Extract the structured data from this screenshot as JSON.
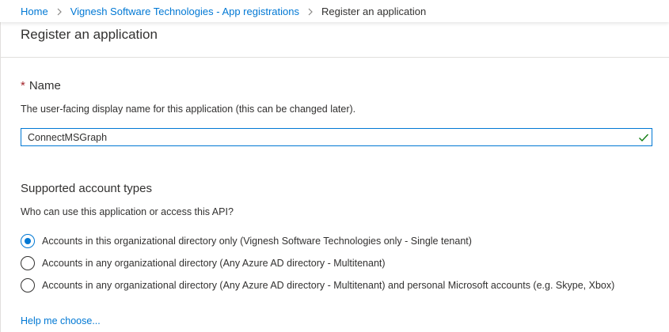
{
  "breadcrumb": {
    "home": "Home",
    "parent": "Vignesh Software Technologies - App registrations",
    "current": "Register an application"
  },
  "page": {
    "title": "Register an application"
  },
  "name_section": {
    "required_marker": "*",
    "heading": "Name",
    "description": "The user-facing display name for this application (this can be changed later).",
    "input_value": "ConnectMSGraph",
    "valid": true
  },
  "account_types": {
    "heading": "Supported account types",
    "question": "Who can use this application or access this API?",
    "options": [
      {
        "label": "Accounts in this organizational directory only (Vignesh Software Technologies only - Single tenant)",
        "selected": true
      },
      {
        "label": "Accounts in any organizational directory (Any Azure AD directory - Multitenant)",
        "selected": false
      },
      {
        "label": "Accounts in any organizational directory (Any Azure AD directory - Multitenant) and personal Microsoft accounts (e.g. Skype, Xbox)",
        "selected": false
      }
    ],
    "help_link": "Help me choose..."
  },
  "colors": {
    "accent": "#0078d4",
    "required": "#a4262c",
    "valid": "#107c10"
  }
}
